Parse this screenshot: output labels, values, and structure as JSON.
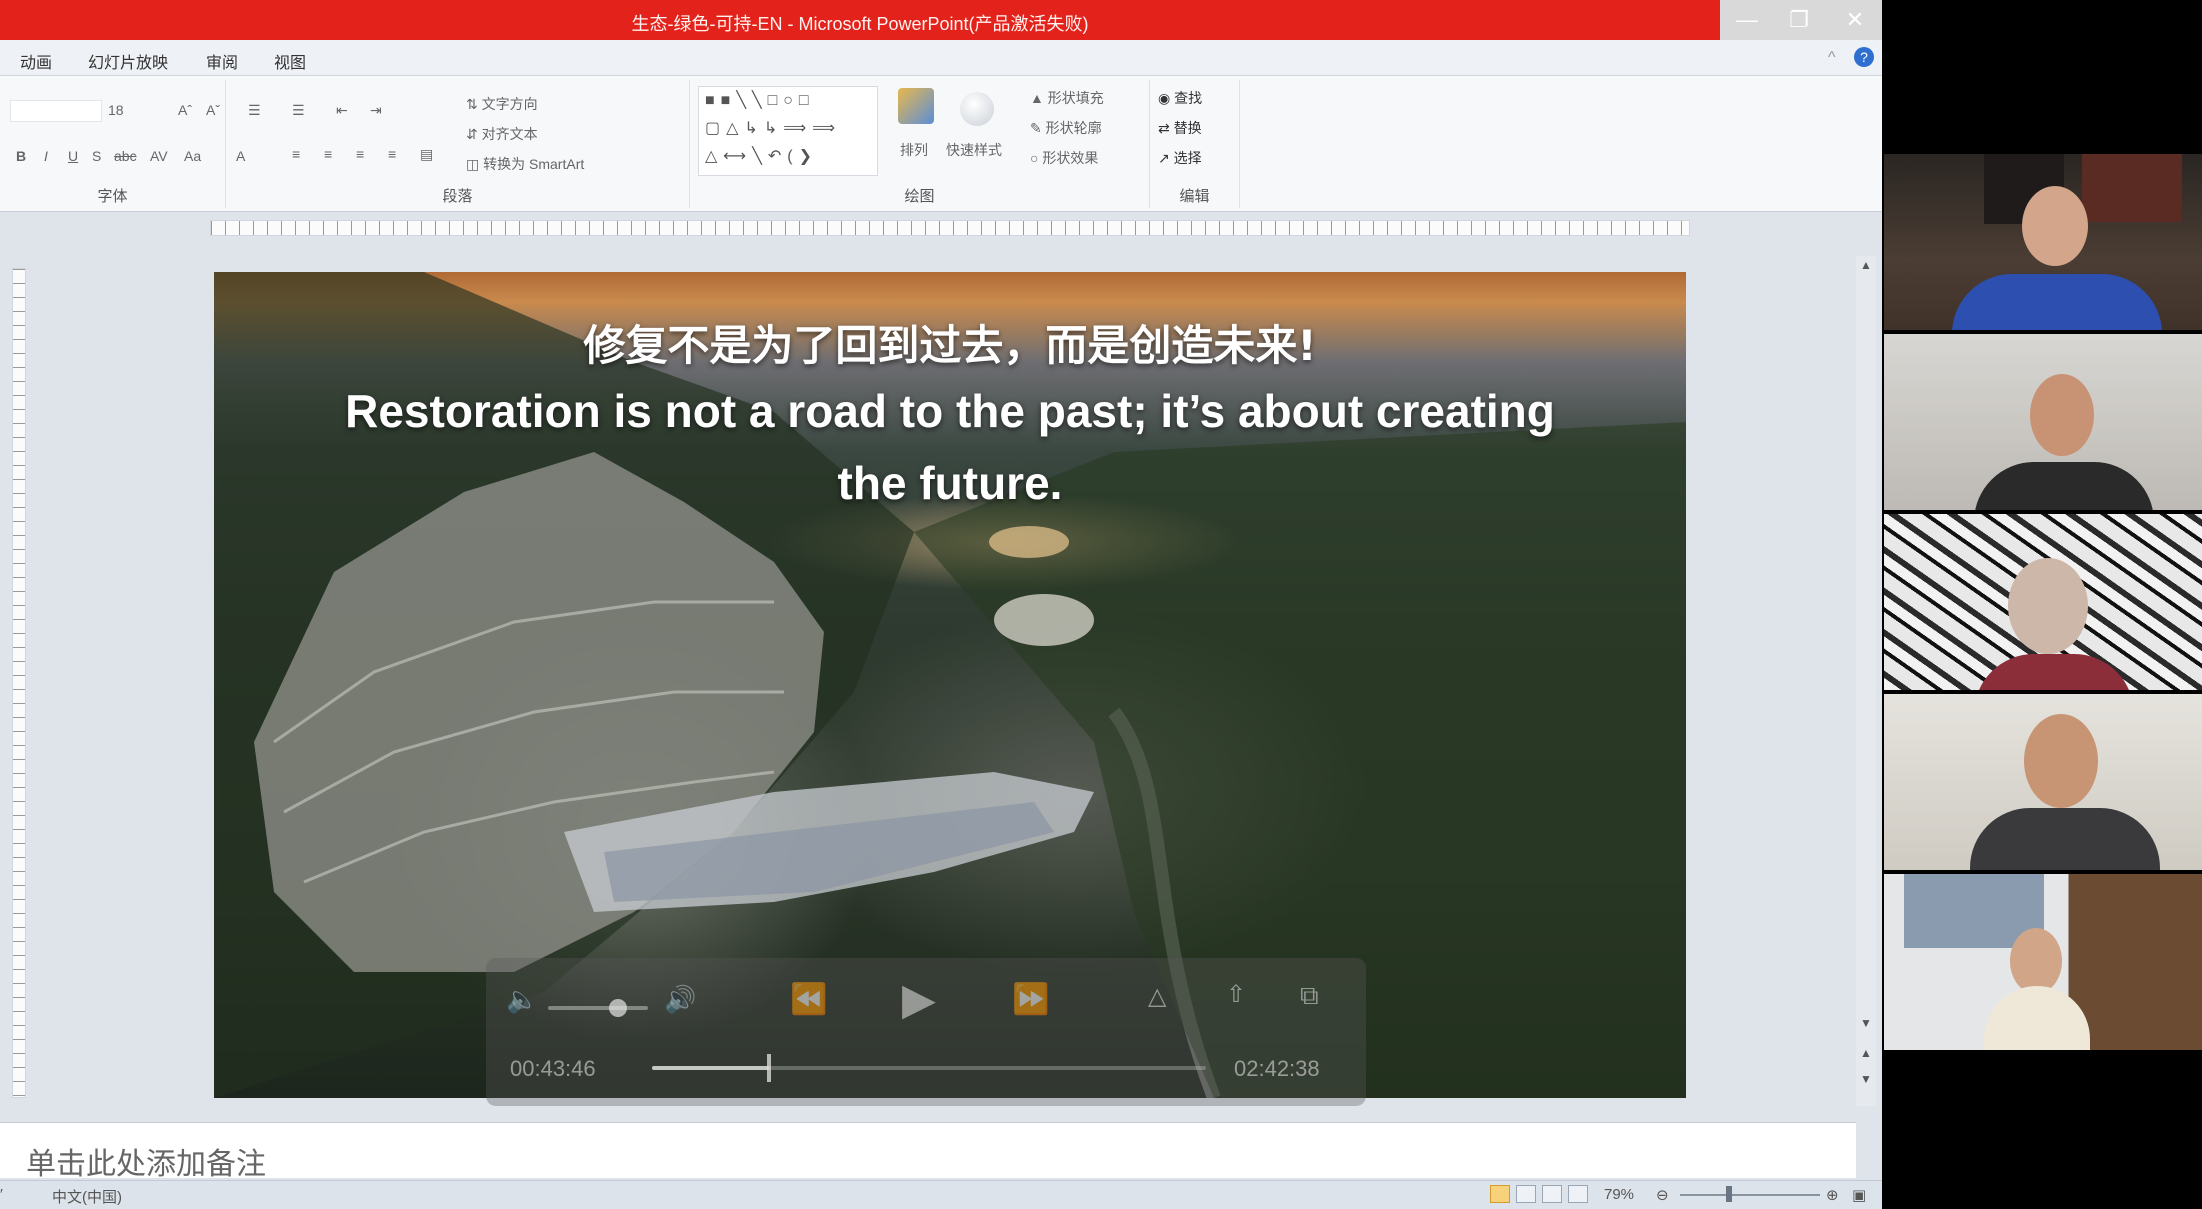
{
  "window": {
    "title": "生态-绿色-可持-EN - Microsoft PowerPoint(产品激活失败)",
    "minimize_icon": "minimize-icon",
    "restore_icon": "restore-icon",
    "close_icon": "close-icon"
  },
  "menu": {
    "items": [
      "动画",
      "幻灯片放映",
      "审阅",
      "视图"
    ]
  },
  "ribbon": {
    "font_size": "18",
    "groups": {
      "font": "字体",
      "paragraph": "段落",
      "drawing": "绘图",
      "editing": "编辑"
    },
    "paragraph_items": [
      "文字方向",
      "对齐文本",
      "转换为 SmartArt"
    ],
    "drawing_items": [
      "排列",
      "快速样式",
      "形状填充",
      "形状轮廓",
      "形状效果"
    ],
    "editing_items": [
      "查找",
      "替换",
      "选择"
    ]
  },
  "slide": {
    "line_cn": "修复不是为了回到过去，而是创造未来!",
    "line_en_1": "Restoration is not a road to the past; it’s about creating",
    "line_en_2": "the future."
  },
  "player": {
    "elapsed": "00:43:46",
    "remaining": "02:42:38",
    "volume_level": 0.7,
    "progress": 0.212
  },
  "notes": {
    "placeholder": "单击此处添加备注"
  },
  "status": {
    "language": "中文(中国)",
    "zoom": "79%"
  },
  "colors": {
    "title_bar": "#e3231b",
    "accent": "#2f6fd0"
  }
}
